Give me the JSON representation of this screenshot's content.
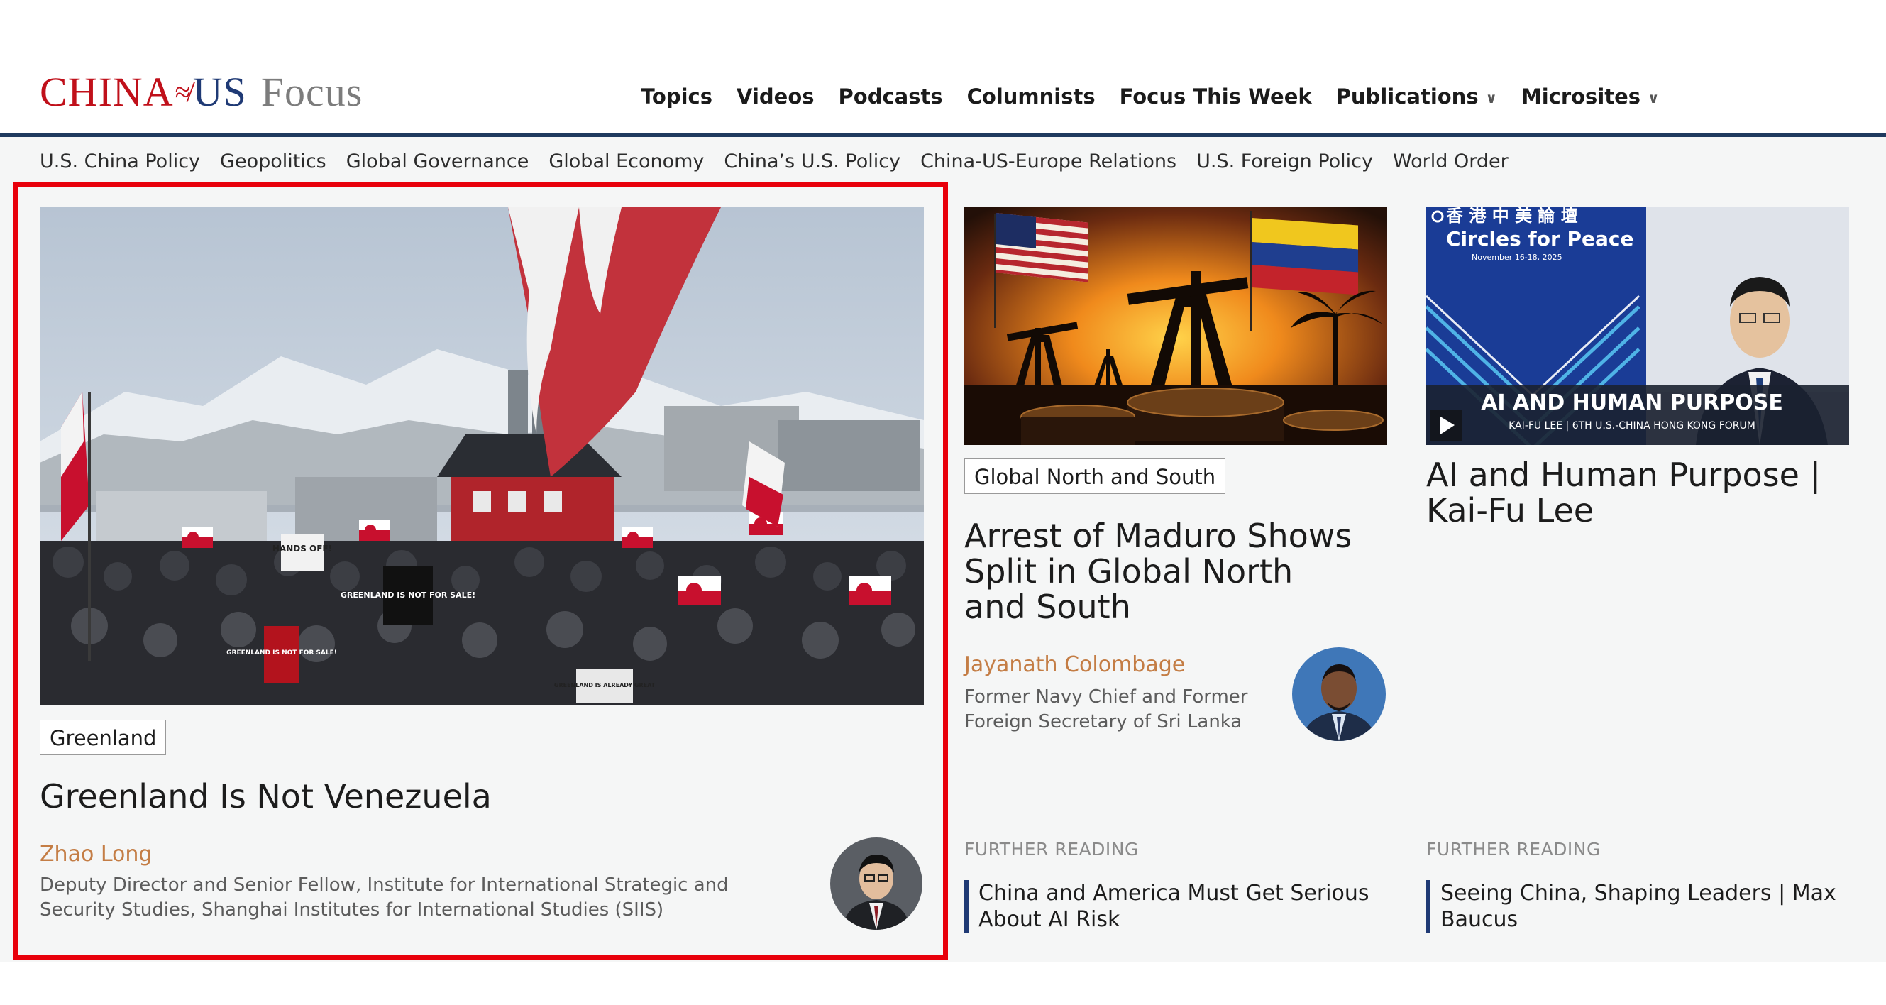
{
  "header": {
    "logo": {
      "china": "CHINA",
      "us": "US",
      "focus": "Focus"
    },
    "nav": [
      {
        "label": "Topics",
        "dropdown": false
      },
      {
        "label": "Videos",
        "dropdown": false
      },
      {
        "label": "Podcasts",
        "dropdown": false
      },
      {
        "label": "Columnists",
        "dropdown": false
      },
      {
        "label": "Focus This Week",
        "dropdown": false
      },
      {
        "label": "Publications",
        "dropdown": true
      },
      {
        "label": "Microsites",
        "dropdown": true
      }
    ]
  },
  "topics": [
    "U.S. China Policy",
    "Geopolitics",
    "Global Governance",
    "Global Economy",
    "China’s U.S. Policy",
    "China-US-Europe Relations",
    "U.S. Foreign Policy",
    "World Order"
  ],
  "feature": {
    "tag": "Greenland",
    "title": "Greenland Is Not Venezuela",
    "author": "Zhao Long",
    "bio": "Deputy Director and Senior Fellow, Institute for International Strategic and Security Studies, Shanghai Institutes for International Studies (SIIS)",
    "image_signs": [
      "HANDS OFF!",
      "GREENLAND IS NOT FOR SALE!",
      "GREENLAND IS NOT FOR SALE!",
      "GREENLAND IS ALREADY GREAT"
    ]
  },
  "article2": {
    "tag": "Global North and South",
    "title": "Arrest of Maduro Shows Split in Global North and South",
    "author": "Jayanath Colombage",
    "bio": "Former Navy Chief and Former Foreign Secretary of Sri Lanka",
    "further_reading_label": "FURTHER READING",
    "further_reading": "China and America Must Get Serious About AI Risk"
  },
  "article3": {
    "title": "AI and Human Purpose | Kai-Fu Lee",
    "video": {
      "event_cn": "香 港 中 美 論 壇",
      "event_name": "Circles for Peace",
      "event_dates": "November 16-18, 2025",
      "headline": "AI AND HUMAN PURPOSE",
      "subline": "KAI-FU LEE | 6TH U.S.-CHINA HONG KONG FORUM"
    },
    "further_reading_label": "FURTHER READING",
    "further_reading": "Seeing China, Shaping Leaders | Max Baucus"
  },
  "colors": {
    "brand_red": "#c0101a",
    "brand_navy": "#1f3a75",
    "author_orange": "#c47d45",
    "highlight": "#e8000b"
  }
}
